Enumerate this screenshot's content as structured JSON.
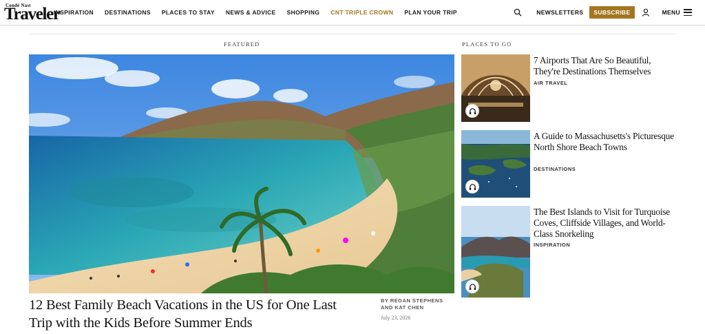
{
  "header": {
    "logo_top": "Condé Nast",
    "logo_main": "Traveler",
    "nav": [
      {
        "label": "INSPIRATION"
      },
      {
        "label": "DESTINATIONS"
      },
      {
        "label": "PLACES TO STAY"
      },
      {
        "label": "NEWS & ADVICE"
      },
      {
        "label": "SHOPPING"
      },
      {
        "label": "CNT TRIPLE CROWN",
        "accent": true
      },
      {
        "label": "PLAN YOUR TRIP"
      }
    ],
    "search_icon": "search-icon",
    "newsletters_label": "NEWSLETTERS",
    "subscribe_label": "SUBSCRIBE",
    "user_icon": "user-icon",
    "menu_label": "MENU",
    "menu_icon": "hamburger-icon"
  },
  "colors": {
    "accent": "#a3761f",
    "text": "#111111"
  },
  "featured": {
    "label": "FEATURED",
    "title": "12 Best Family Beach Vacations in the US for One Last Trip with the Kids Before Summer Ends",
    "byline": "BY REGAN STEPHENS AND KAT CHEN",
    "date": "July 23, 2026"
  },
  "places": {
    "label": "PLACES TO GO",
    "items": [
      {
        "title": "7 Airports That Are So Beautiful, They're Destinations Themselves",
        "rubric": "AIR TRAVEL",
        "icon": "headphones-icon"
      },
      {
        "title": "A Guide to Massachusetts's Picturesque North Shore Beach Towns",
        "rubric": "DESTINATIONS",
        "icon": "headphones-icon"
      },
      {
        "title": "The Best Islands to Visit for Turquoise Coves, Cliffside Villages, and World-Class Snorkeling",
        "rubric": "INSPIRATION",
        "icon": "headphones-icon"
      }
    ]
  }
}
